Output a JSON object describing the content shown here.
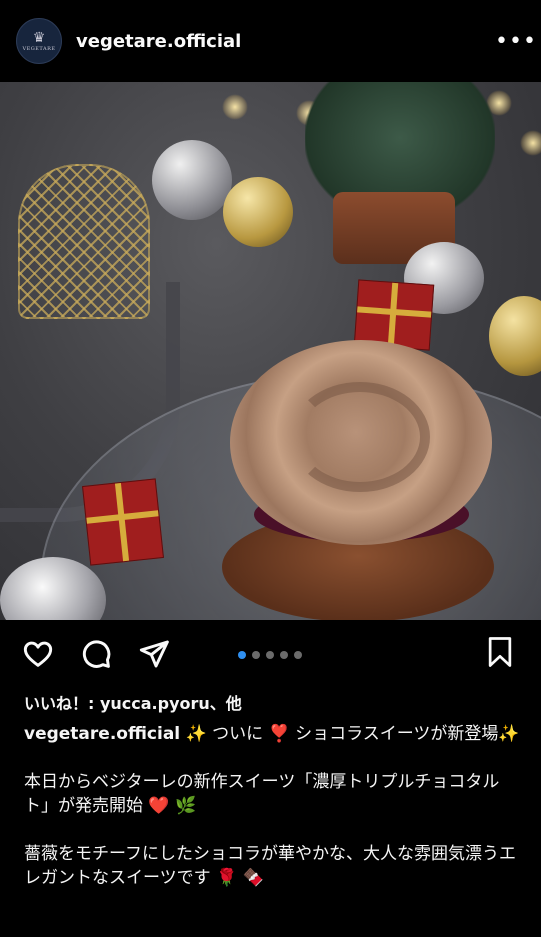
{
  "header": {
    "avatar_text": "VEGETARE",
    "username": "vegetare.official",
    "more_label": "•••"
  },
  "post": {
    "carousel": {
      "total": 5,
      "active_index": 0
    },
    "likes_text": "いいね！: yucca.pyoru、他",
    "caption": {
      "username": "vegetare.official",
      "line1": " ✨ ついに ❣️ ショコラスイーツが新登場✨",
      "para2": "本日からベジターレの新作スイーツ「濃厚トリプルチョコタルト」が発売開始 ❤️ 🌿",
      "para3": "薔薇をモチーフにしたショコラが華やかな、大人な雰囲気漂うエレガントなスイーツです 🌹 🍫"
    }
  },
  "icons": {
    "like": "heart-icon",
    "comment": "comment-icon",
    "share": "send-icon",
    "save": "bookmark-icon",
    "more": "more-icon"
  },
  "colors": {
    "background": "#000000",
    "text": "#f5f5f5",
    "carousel_active": "#2f8ff0",
    "carousel_inactive": "#6b6b6b"
  }
}
